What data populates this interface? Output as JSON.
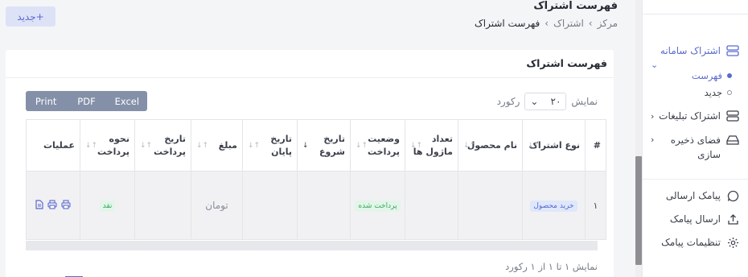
{
  "header": {
    "new_button": "+جدید",
    "title": "فهرست اشتراک",
    "breadcrumb": [
      "مرکز",
      "اشتراک",
      "فهرست اشتراک"
    ]
  },
  "card": {
    "title": "فهرست اشتراک",
    "export": [
      "Print",
      "PDF",
      "Excel"
    ],
    "length": {
      "prefix": "نمایش",
      "value": "۲۰",
      "suffix": "رکورد"
    },
    "columns": [
      "#",
      "نوع اشتراک",
      "نام محصول",
      "تعداد ماژول ها",
      "وضعیت پرداخت",
      "تاریخ شروع",
      "تاریخ پایان",
      "مبلغ",
      "تاریخ پرداخت",
      "نحوه پرداخت",
      "عملیات"
    ],
    "rows": [
      {
        "num": "۱",
        "type": "خرید محصول",
        "product": "",
        "modules": "",
        "status": "پرداخت شده",
        "start": "",
        "end": "",
        "amount": "تومان",
        "paid_date": "",
        "method": "نقد"
      }
    ],
    "info": "نمایش ۱ تا ۱ از ۱ رکورد"
  },
  "sidebar": {
    "items": [
      {
        "label": "اشتراک سامانه",
        "icon": "server-icon"
      },
      {
        "label": "فهرست"
      },
      {
        "label": "جدید"
      },
      {
        "label": "اشتراک تبلیغات",
        "icon": "server-icon"
      },
      {
        "label": "فضای ذخیره سازی",
        "icon": "storage-icon"
      },
      {
        "label": "پیامک ارسالی",
        "icon": "chat-icon"
      },
      {
        "label": "ارسال پیامک",
        "icon": "upload-icon"
      },
      {
        "label": "تنظیمات پیامک",
        "icon": "gear-icon"
      }
    ]
  },
  "colors": {
    "accent": "#5a6acf",
    "export_bg": "#8390a8",
    "success": "#37a960"
  }
}
